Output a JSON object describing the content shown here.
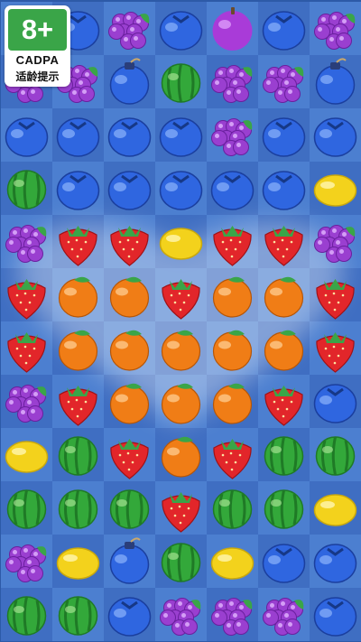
{
  "age_badge": {
    "rating": "8+",
    "organization": "CADPA",
    "label": "适龄提示",
    "color": "#3aa548"
  },
  "board": {
    "rows": 12,
    "cols": 7,
    "grid": [
      [
        "blueberry",
        "blueberry",
        "grape",
        "blueberry",
        "plum",
        "blueberry",
        "grape"
      ],
      [
        "grape",
        "grape",
        "blue-bomb",
        "watermelon",
        "grape",
        "grape",
        "blue-bomb"
      ],
      [
        "blueberry",
        "blueberry",
        "blueberry",
        "blueberry",
        "grape",
        "blueberry",
        "blueberry"
      ],
      [
        "watermelon",
        "blueberry",
        "blueberry",
        "blueberry",
        "blueberry",
        "blueberry",
        "lemon"
      ],
      [
        "grape",
        "strawberry",
        "strawberry",
        "lemon",
        "strawberry",
        "strawberry",
        "grape"
      ],
      [
        "strawberry",
        "orange",
        "orange",
        "strawberry",
        "orange",
        "orange",
        "strawberry"
      ],
      [
        "strawberry",
        "orange",
        "orange",
        "orange",
        "orange",
        "orange",
        "strawberry"
      ],
      [
        "grape",
        "strawberry",
        "orange",
        "orange",
        "orange",
        "strawberry",
        "blueberry"
      ],
      [
        "lemon",
        "watermelon",
        "strawberry",
        "orange",
        "strawberry",
        "watermelon",
        "watermelon"
      ],
      [
        "watermelon",
        "watermelon",
        "watermelon",
        "strawberry",
        "watermelon",
        "watermelon",
        "lemon"
      ],
      [
        "grape",
        "lemon",
        "blue-bomb",
        "watermelon",
        "lemon",
        "blueberry",
        "blueberry"
      ],
      [
        "watermelon",
        "watermelon",
        "blueberry",
        "grape",
        "grape",
        "grape",
        "blueberry"
      ]
    ],
    "heart_pattern_fruit": "strawberry",
    "colors": {
      "tile_light": "#4c7fd0",
      "tile_dark": "#3f6ec2",
      "blueberry": "#2f66e0",
      "grape": "#9a3fd0",
      "plum": "#a93bd8",
      "watermelon": "#33a83a",
      "lemon": "#f3d21c",
      "strawberry": "#e2262a",
      "orange": "#f07d16",
      "heart_glow": "#ffffff"
    }
  }
}
